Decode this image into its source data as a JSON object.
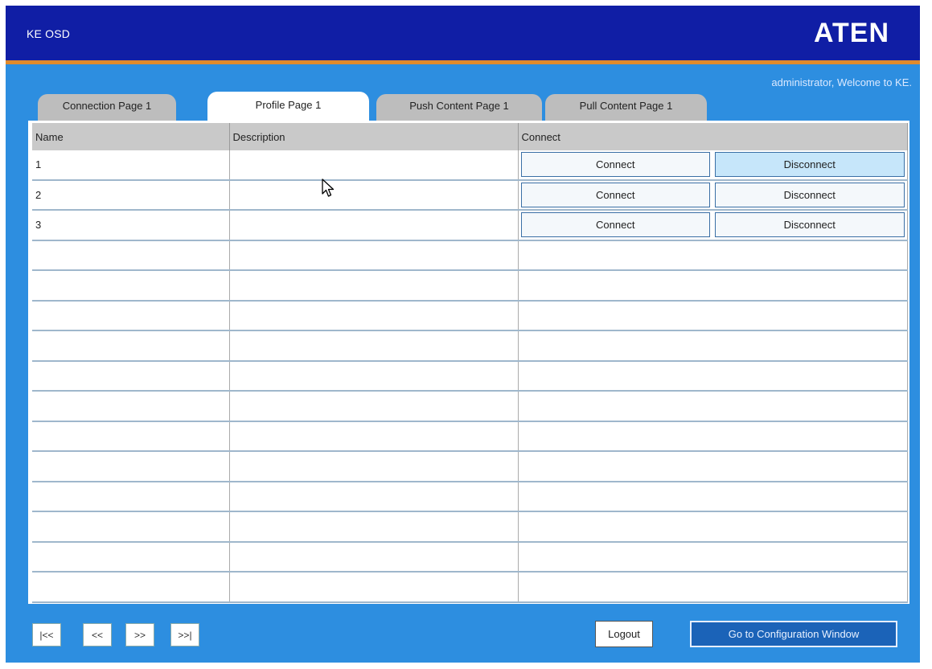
{
  "window": {
    "title": "KE OSD",
    "brand": "ATEN"
  },
  "header": {
    "welcome": "administrator, Welcome to KE."
  },
  "tabs": [
    {
      "label": "Connection Page 1",
      "active": false
    },
    {
      "label": "Profile Page 1",
      "active": true
    },
    {
      "label": "Push Content Page 1",
      "active": false
    },
    {
      "label": "Pull Content Page 1",
      "active": false
    }
  ],
  "table": {
    "columns": [
      "Name",
      "Description",
      "Connect"
    ],
    "rows": [
      {
        "name": "1",
        "description": "",
        "connect_label": "Connect",
        "disconnect_label": "Disconnect"
      },
      {
        "name": "2",
        "description": "",
        "connect_label": "Connect",
        "disconnect_label": "Disconnect"
      },
      {
        "name": "3",
        "description": "",
        "connect_label": "Connect",
        "disconnect_label": "Disconnect"
      }
    ],
    "empty_rows": 12
  },
  "footer": {
    "first": "|<<",
    "prev": "<<",
    "next": ">>",
    "last": ">>|",
    "logout": "Logout",
    "config": "Go to Configuration Window"
  },
  "colors": {
    "titlebar": "#101ea5",
    "accent_stripe": "#e08a2c",
    "panel": "#2d8ee0",
    "highlight_button": "#c6e6fa"
  },
  "icons": {
    "cursor": "mouse-pointer-icon"
  }
}
